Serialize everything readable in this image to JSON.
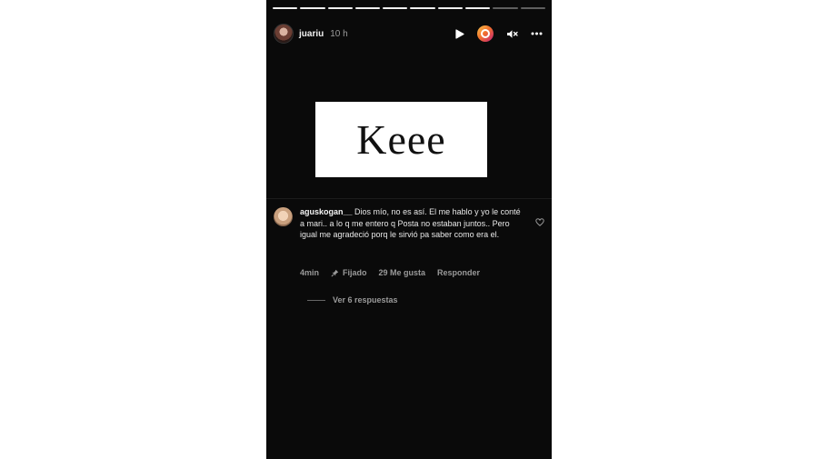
{
  "story": {
    "progress": {
      "total_segments": 10,
      "completed_segments": 8
    },
    "header": {
      "username": "juariu",
      "time": "10 h",
      "icons": [
        "play-icon",
        "mention-sticker-icon",
        "mute-icon",
        "more-options-icon"
      ]
    },
    "image_text": "Keee",
    "comment": {
      "username": "aguskogan__",
      "text": "Dios mío, no es así. El me hablo y yo le conté a mari.. a lo q me entero q Posta no estaban juntos.. Pero igual me agradeció porq le sirvió pa saber como era el.",
      "time": "4min",
      "pinned_label": "Fijado",
      "likes": "29 Me gusta",
      "reply_label": "Responder",
      "view_replies": "Ver 6 respuestas"
    },
    "colors": {
      "background": "#0a0a0a",
      "text": "#e8e8e8",
      "muted": "#9a9a9a"
    }
  }
}
